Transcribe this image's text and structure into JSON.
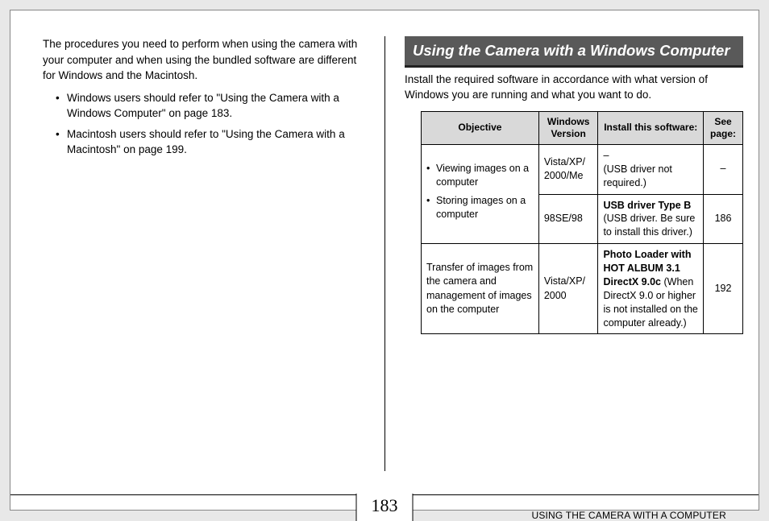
{
  "left": {
    "intro": "The procedures you need to perform when using the camera with your computer and when using the bundled software are different for Windows and the Macintosh.",
    "bullets": [
      "Windows users should refer to \"Using the Camera with a Windows Computer\" on page 183.",
      "Macintosh users should refer to \"Using the Camera with a Macintosh\" on page 199."
    ]
  },
  "right": {
    "section_title": "Using the Camera with a Windows Computer",
    "intro": "Install the required software in accordance with what version of Windows you are running and what you want to do.",
    "table": {
      "headers": {
        "objective": "Objective",
        "version": "Windows Version",
        "software": "Install this software:",
        "page": "See page:"
      },
      "rows": [
        {
          "objective_list": [
            "Viewing images on a computer",
            "Storing images on a computer"
          ],
          "version": "Vista/XP/ 2000/Me",
          "software_plain_pre": "–",
          "software_plain": "(USB driver not required.)",
          "page": "–"
        },
        {
          "version": "98SE/98",
          "software_bold": "USB driver Type B",
          "software_plain": "(USB driver. Be sure to install this driver.)",
          "page": "186"
        },
        {
          "objective_text": "Transfer of images from the camera and management of images on the computer",
          "version": "Vista/XP/ 2000",
          "software_bold1": "Photo Loader with HOT ALBUM 3.1",
          "software_bold2": "DirectX 9.0c",
          "software_plain": " (When DirectX 9.0 or higher is not installed on the computer already.)",
          "page": "192"
        }
      ]
    }
  },
  "footer": {
    "page_number": "183",
    "running_title": "USING THE CAMERA WITH A COMPUTER"
  }
}
